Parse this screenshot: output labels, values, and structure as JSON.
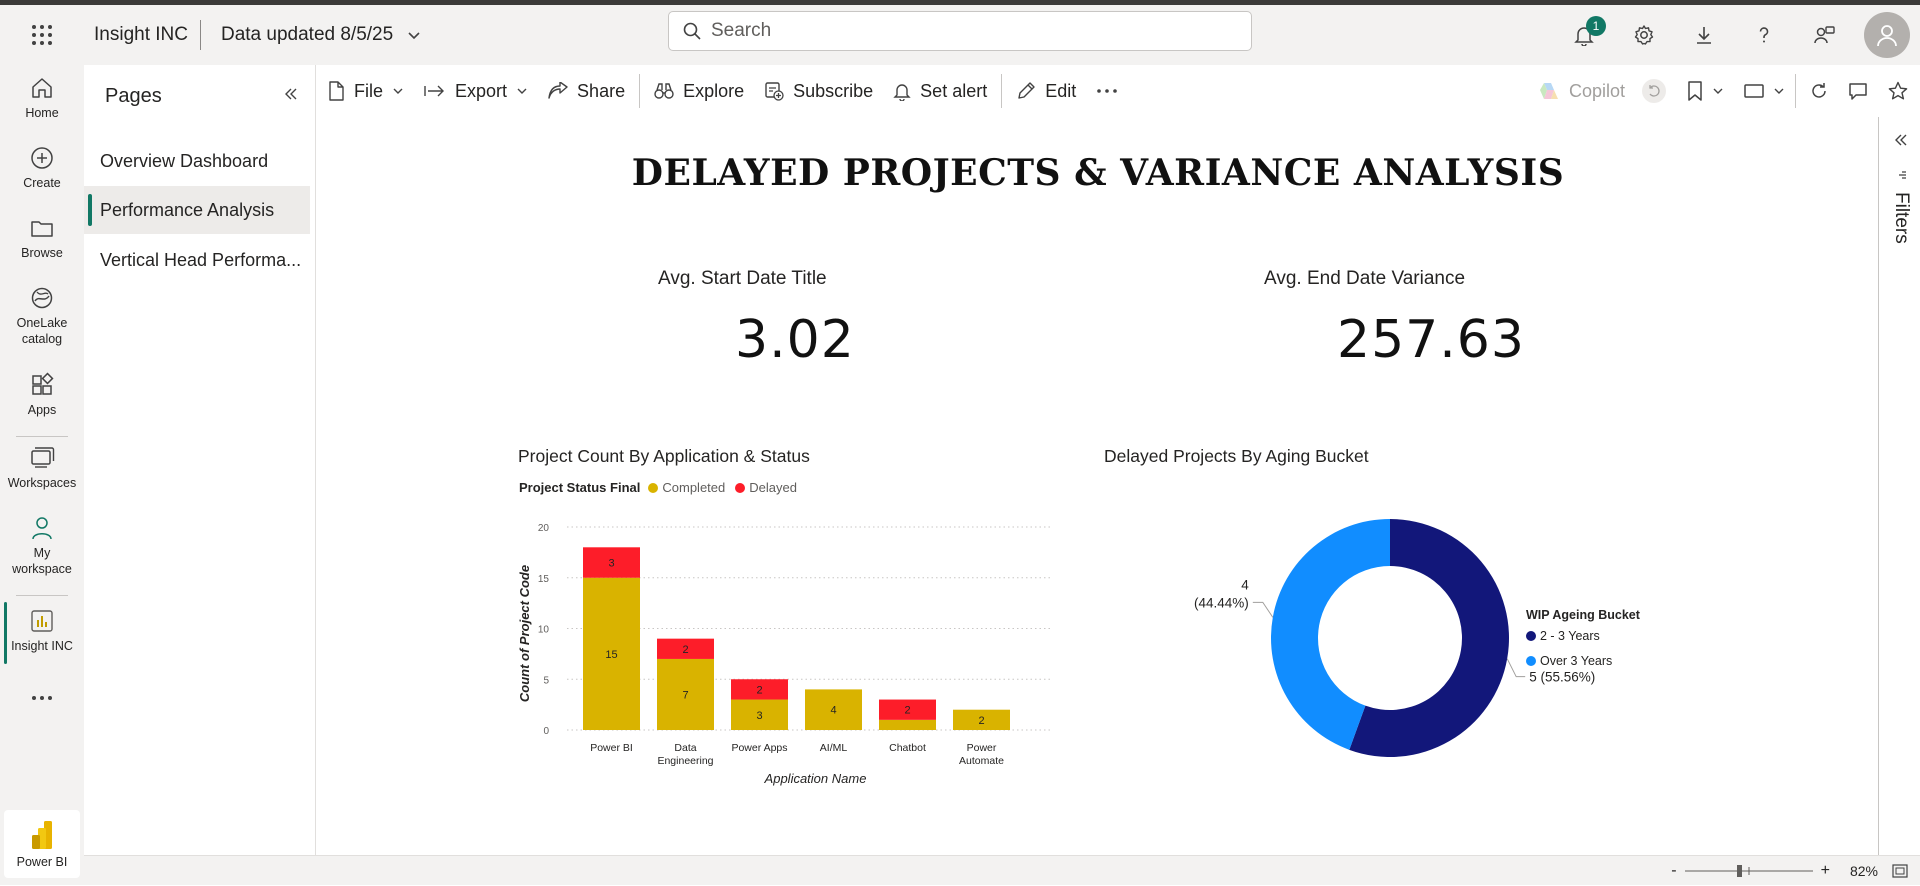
{
  "app": {
    "name": "Insight INC",
    "data_updated": "Data updated 8/5/25"
  },
  "search": {
    "placeholder": "Search"
  },
  "header": {
    "notification_count": "1"
  },
  "nav": {
    "home": "Home",
    "create": "Create",
    "browse": "Browse",
    "onelake_line1": "OneLake",
    "onelake_line2": "catalog",
    "apps": "Apps",
    "workspaces": "Workspaces",
    "my_workspace_line1": "My",
    "my_workspace_line2": "workspace",
    "insight": "Insight INC",
    "power_bi": "Power BI"
  },
  "pages": {
    "title": "Pages",
    "items": [
      {
        "label": "Overview Dashboard"
      },
      {
        "label": "Performance Analysis"
      },
      {
        "label": "Vertical Head Performa..."
      }
    ]
  },
  "toolbar": {
    "file": "File",
    "export": "Export",
    "share": "Share",
    "explore": "Explore",
    "subscribe": "Subscribe",
    "set_alert": "Set alert",
    "edit": "Edit",
    "copilot": "Copilot"
  },
  "filters": {
    "label": "Filters"
  },
  "report": {
    "title": "DELAYED PROJECTS & VARIANCE ANALYSIS",
    "kpi1": {
      "title": "Avg. Start Date Title",
      "value": "3.02"
    },
    "kpi2": {
      "title": "Avg. End Date Variance",
      "value": "257.63"
    }
  },
  "bar_visual": {
    "title": "Project Count By Application & Status",
    "legend_title": "Project Status Final",
    "legend": [
      "Completed",
      "Delayed"
    ]
  },
  "donut_visual": {
    "title": "Delayed Projects By Aging Bucket",
    "legend_title": "WIP Ageing Bucket",
    "legend": [
      "2 - 3 Years",
      "Over 3 Years"
    ]
  },
  "zoom": {
    "level": "82%"
  },
  "colors": {
    "accent": "#117865",
    "completed": "#D9B300",
    "delayed": "#FD1D29",
    "bucket_2_3": "#12177A",
    "bucket_over3": "#118DFF"
  },
  "chart_data": [
    {
      "type": "bar",
      "stacked": true,
      "title": "Project Count By Application & Status",
      "categories": [
        [
          "Power BI"
        ],
        [
          "Data",
          "Engineering"
        ],
        [
          "Power Apps"
        ],
        [
          "AI/ML"
        ],
        [
          "Chatbot"
        ],
        [
          "Power",
          "Automate"
        ]
      ],
      "series": [
        {
          "name": "Completed",
          "color": "#D9B300",
          "values": [
            15,
            7,
            3,
            4,
            1,
            2
          ],
          "labels": [
            "15",
            "7",
            "3",
            "4",
            "",
            "2"
          ]
        },
        {
          "name": "Delayed",
          "color": "#FD1D29",
          "values": [
            3,
            2,
            2,
            0,
            2,
            0
          ],
          "labels": [
            "3",
            "2",
            "2",
            "",
            "2",
            ""
          ]
        }
      ],
      "xlabel": "Application Name",
      "ylabel": "Count of Project Code",
      "ylim": [
        0,
        20
      ],
      "yticks": [
        0,
        5,
        10,
        15,
        20
      ],
      "grid": true
    },
    {
      "type": "pie",
      "donut": true,
      "title": "Delayed Projects By Aging Bucket",
      "slices": [
        {
          "name": "2 - 3 Years",
          "value": 5,
          "label": "5 (55.56%)",
          "color": "#12177A"
        },
        {
          "name": "Over 3 Years",
          "value": 4,
          "label_line1": "4",
          "label_line2": "(44.44%)",
          "color": "#118DFF"
        }
      ],
      "legend_position": "right"
    }
  ]
}
